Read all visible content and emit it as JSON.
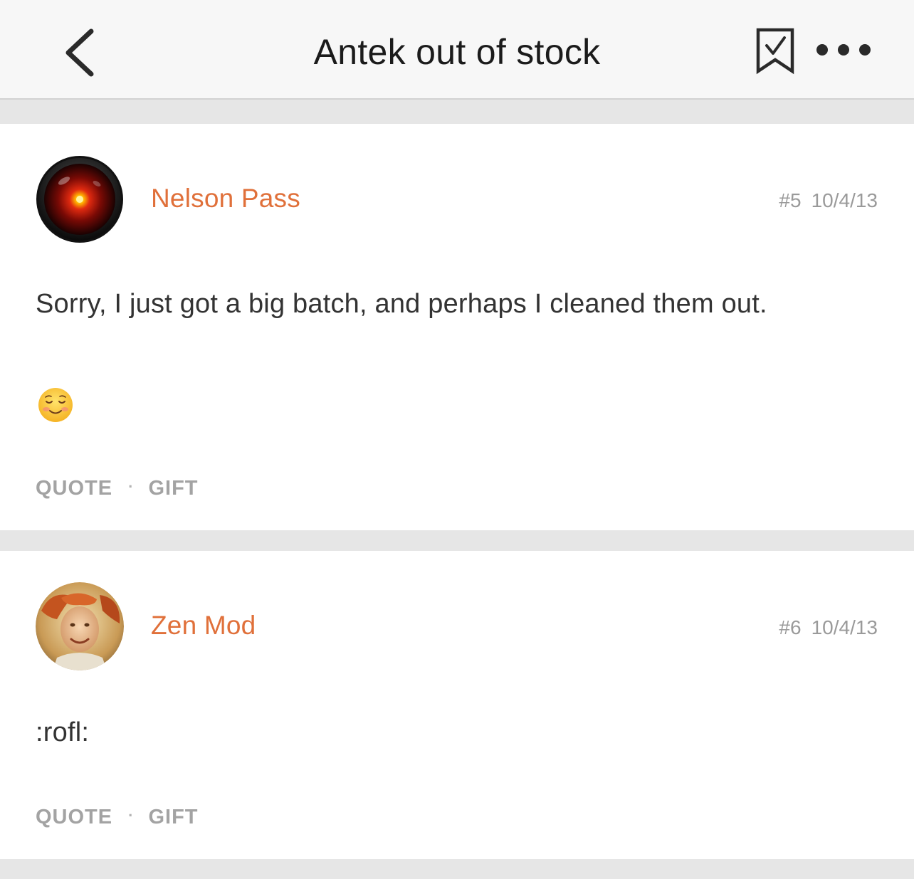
{
  "header": {
    "title": "Antek out of stock",
    "back_icon": "chevron-left-icon",
    "bookmark_icon": "bookmark-check-icon",
    "more_icon": "more-horizontal-icon"
  },
  "posts": [
    {
      "author": "Nelson Pass",
      "number": "#5",
      "date": "10/4/13",
      "text": "Sorry, I just got a big batch, and perhaps I cleaned them out.",
      "emoji": "smiling-face-icon",
      "actions": {
        "quote": "QUOTE",
        "separator": "·",
        "gift": "GIFT"
      }
    },
    {
      "author": "Zen Mod",
      "number": "#6",
      "date": "10/4/13",
      "text": ":rofl:",
      "actions": {
        "quote": "QUOTE",
        "separator": "·",
        "gift": "GIFT"
      }
    }
  ],
  "colors": {
    "author": "#e0703a",
    "meta": "#9a9a9a",
    "action": "#a3a3a3",
    "background": "#e6e6e6",
    "card": "#ffffff",
    "header": "#f7f7f7"
  }
}
